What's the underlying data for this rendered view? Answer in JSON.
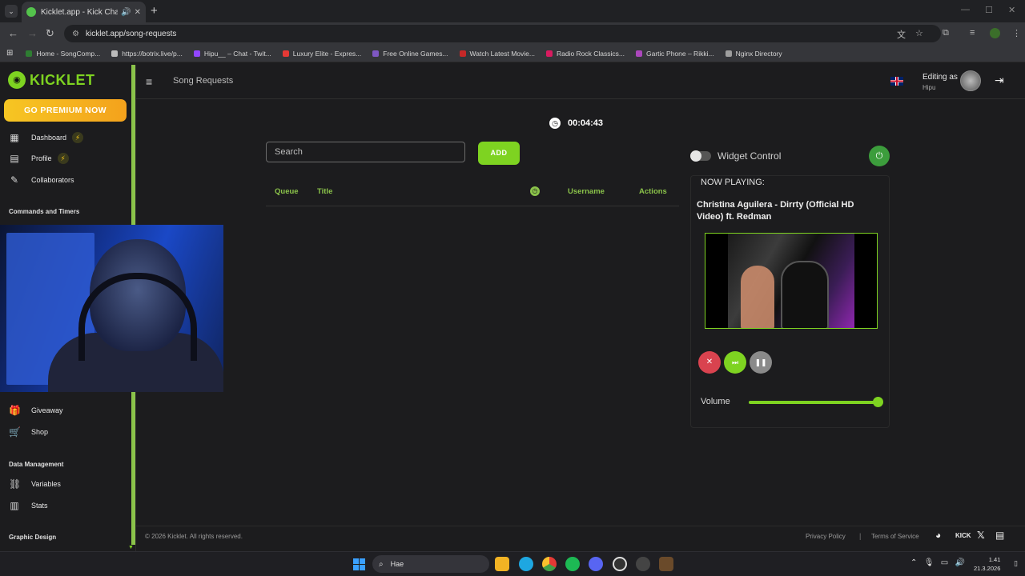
{
  "browser": {
    "tab_title": "Kicklet.app - Kick Chatbot",
    "url": "kicklet.app/song-requests",
    "new_tab": "+",
    "bookmarks": [
      {
        "label": "Home - SongComp...",
        "color": "#2e7d32"
      },
      {
        "label": "https://botrix.live/p...",
        "color": "#bbbbbb"
      },
      {
        "label": "Hipu__ – Chat - Twit...",
        "color": "#9146ff"
      },
      {
        "label": "Luxury Elite - Expres...",
        "color": "#e53935"
      },
      {
        "label": "Free Online Games...",
        "color": "#7e57c2"
      },
      {
        "label": "Watch Latest Movie...",
        "color": "#c62828"
      },
      {
        "label": "Radio Rock Classics...",
        "color": "#d81b60"
      },
      {
        "label": "Gartic Phone – Rikki...",
        "color": "#ab47bc"
      },
      {
        "label": "Nginx Directory",
        "color": "#9e9e9e"
      }
    ]
  },
  "sidebar": {
    "logo": "KICKLET",
    "premium_button": "GO PREMIUM NOW",
    "items_top": [
      {
        "label": "Dashboard",
        "icon": "dashboard-icon",
        "bolt": true
      },
      {
        "label": "Profile",
        "icon": "profile-icon",
        "bolt": true
      },
      {
        "label": "Collaborators",
        "icon": "collaborators-icon",
        "bolt": false
      }
    ],
    "section_commands": "Commands and Timers",
    "items_bottom": [
      {
        "label": "Giveaway",
        "icon": "gift-icon"
      },
      {
        "label": "Shop",
        "icon": "cart-icon"
      }
    ],
    "section_data": "Data Management",
    "items_data": [
      {
        "label": "Variables",
        "icon": "link-icon"
      },
      {
        "label": "Stats",
        "icon": "chart-icon"
      }
    ],
    "section_graphic": "Graphic Design"
  },
  "header": {
    "title": "Song Requests",
    "editing_as": "Editing as",
    "username": "Hipu"
  },
  "main": {
    "timer": "00:04:43",
    "search_placeholder": "Search",
    "add_button": "ADD",
    "columns": {
      "queue": "Queue",
      "title": "Title",
      "username": "Username",
      "actions": "Actions"
    }
  },
  "player": {
    "widget_control": "Widget Control",
    "widget_enabled": false,
    "now_playing_label": "NOW PLAYING:",
    "song_title": "Christina Aguilera - Dirrty (Official HD Video) ft. Redman",
    "volume_label": "Volume",
    "volume": 0.97
  },
  "footer": {
    "copyright": "© 2026 Kicklet. All rights reserved.",
    "privacy": "Privacy Policy",
    "separator": "|",
    "terms": "Terms of Service",
    "kick": "KICK"
  },
  "taskbar": {
    "search_text": "Hae",
    "time": "1.41",
    "date": "21.3.2026"
  },
  "colors": {
    "accent": "#7ed321",
    "premium": "#f6c623",
    "danger": "#d9434f"
  }
}
